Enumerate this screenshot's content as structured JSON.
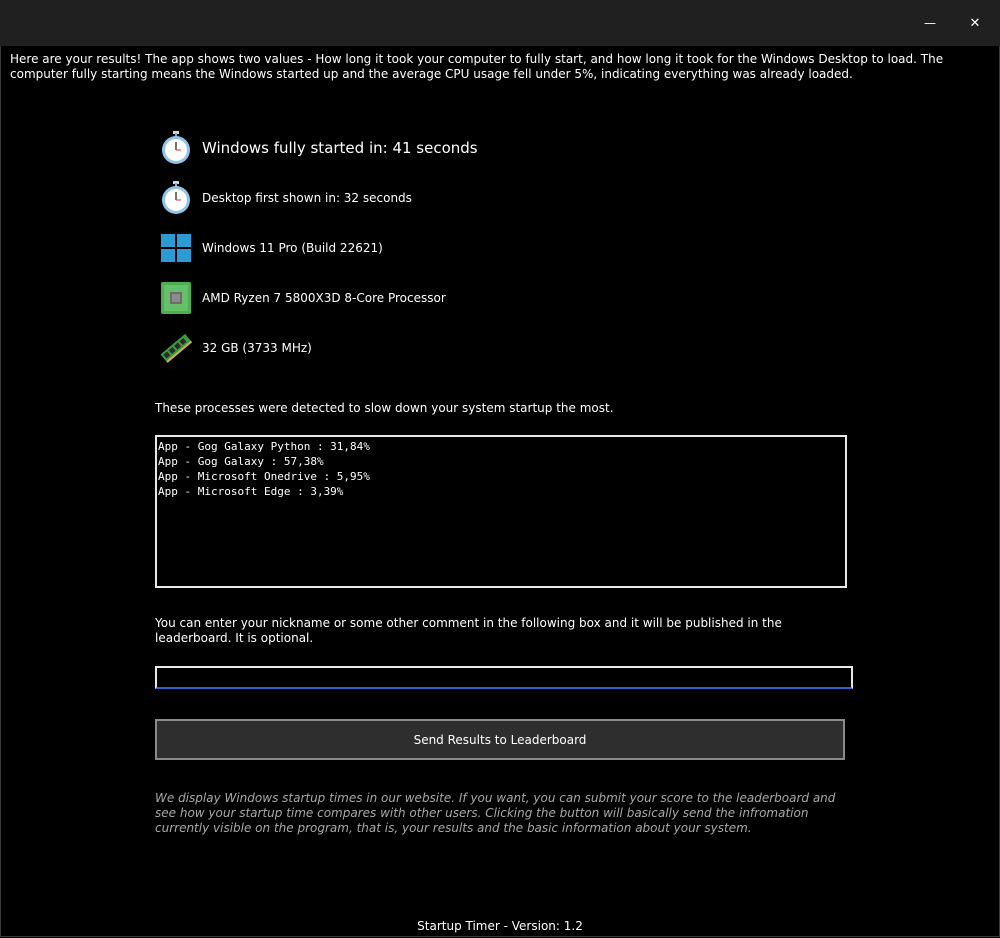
{
  "window": {
    "minimize_glyph": "—",
    "close_glyph": "✕"
  },
  "intro": "Here are your results! The app shows two values - How long it took your computer to fully start, and how long it took for the Windows Desktop to load. The computer fully starting means the Windows started up and the average CPU usage fell under 5%, indicating everything was already loaded.",
  "info": {
    "fully_started": "Windows fully started in: 41 seconds",
    "desktop_shown": "Desktop first shown in: 32 seconds",
    "os": "Windows 11 Pro (Build 22621)",
    "cpu": "AMD Ryzen 7 5800X3D 8-Core Processor",
    "ram": "32 GB (3733 MHz)",
    "icons": [
      "stopwatch-icon",
      "stopwatch-icon",
      "windows-logo-icon",
      "cpu-chip-icon",
      "ram-module-icon"
    ]
  },
  "processes": {
    "label": "These processes were detected to slow down your system startup the most.",
    "items": [
      "App - Gog Galaxy Python : 31,84%",
      "App - Gog Galaxy : 57,38%",
      "App - Microsoft Onedrive : 5,95%",
      "App - Microsoft Edge : 3,39%"
    ]
  },
  "nickname": {
    "label": "You can enter your nickname or some other comment in the following box and it will be published in the leaderboard. It is optional.",
    "value": "",
    "placeholder": ""
  },
  "send_button": "Send Results to Leaderboard",
  "note": "We display Windows startup times in our website. If you want, you can submit your score to the leaderboard and see how your startup time compares with other users. Clicking the button will basically send the infromation currently visible on the program, that is, your results and the basic information about your system.",
  "footer": "Startup Timer - Version: 1.2",
  "colors": {
    "background": "#000000",
    "titlebar": "#202020",
    "button_bg": "#2e2e2e",
    "input_accent": "#2a62c9",
    "note_text": "#a8a8a8"
  }
}
